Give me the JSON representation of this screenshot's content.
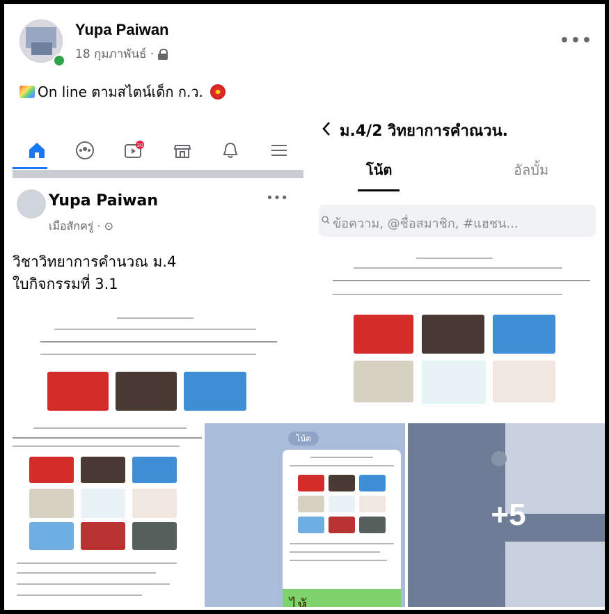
{
  "post": {
    "author": "Yupa Paiwan",
    "date": "18 กุมภาพันธ์ ·",
    "caption": "On line ตามสไตน์เด็ก ก.ว.",
    "more_label": "•••",
    "privacy_icon": "lock-icon"
  },
  "tile1": {
    "nav_icons": [
      "home-icon",
      "groups-icon",
      "watch-icon",
      "marketplace-icon",
      "bell-icon",
      "menu-icon"
    ],
    "watch_badge": "30",
    "inner_author": "Yupa Paiwan",
    "inner_meta": "เมือสักครู่ · ⊙",
    "inner_more": "•••",
    "subject_line1": "วิชาวิทยาการคำนวณ ม.4",
    "subject_line2": "ใบกิจกรรมที่ 3.1"
  },
  "tile2": {
    "back_icon": "back-chevron-icon",
    "title": "ม.4/2 วิทยาการคำณวน.",
    "tab_notes": "โน้ต",
    "tab_albums": "อัลบั้ม",
    "search_placeholder": "ข้อความ, @ชื่อสมาชิก, #แฮชน..."
  },
  "tile4": {
    "pill": "โน้ต",
    "green_text": "ไห้"
  },
  "tile5": {
    "overflow_count": "+5"
  },
  "colors": {
    "accent": "#1877f2",
    "online": "#31a24c",
    "meta_gray": "#65676b"
  }
}
